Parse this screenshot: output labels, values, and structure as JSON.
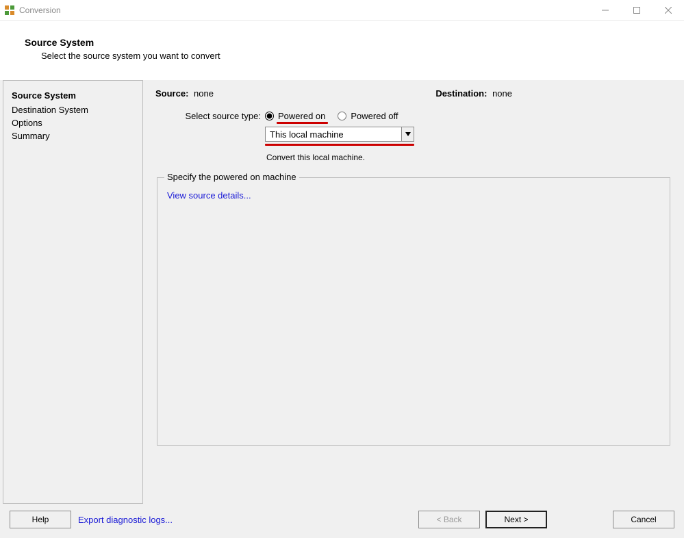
{
  "window_title": "Conversion",
  "header": {
    "title": "Source System",
    "subtitle": "Select the source system you want to convert"
  },
  "sidebar": {
    "items": [
      {
        "label": "Source System",
        "active": true
      },
      {
        "label": "Destination System",
        "active": false
      },
      {
        "label": "Options",
        "active": false
      },
      {
        "label": "Summary",
        "active": false
      }
    ]
  },
  "status": {
    "source_label": "Source:",
    "source_value": "none",
    "destination_label": "Destination:",
    "destination_value": "none"
  },
  "form": {
    "select_type_label": "Select source type:",
    "radio_powered_on": "Powered on",
    "radio_powered_off": "Powered off",
    "dropdown_value": "This local machine",
    "dropdown_helper": "Convert this local machine."
  },
  "groupbox": {
    "legend": "Specify the powered on machine",
    "view_details_link": "View source details..."
  },
  "footer": {
    "help_label": "Help",
    "export_logs_link": "Export diagnostic logs...",
    "back_label": "< Back",
    "next_label": "Next >",
    "cancel_label": "Cancel"
  }
}
